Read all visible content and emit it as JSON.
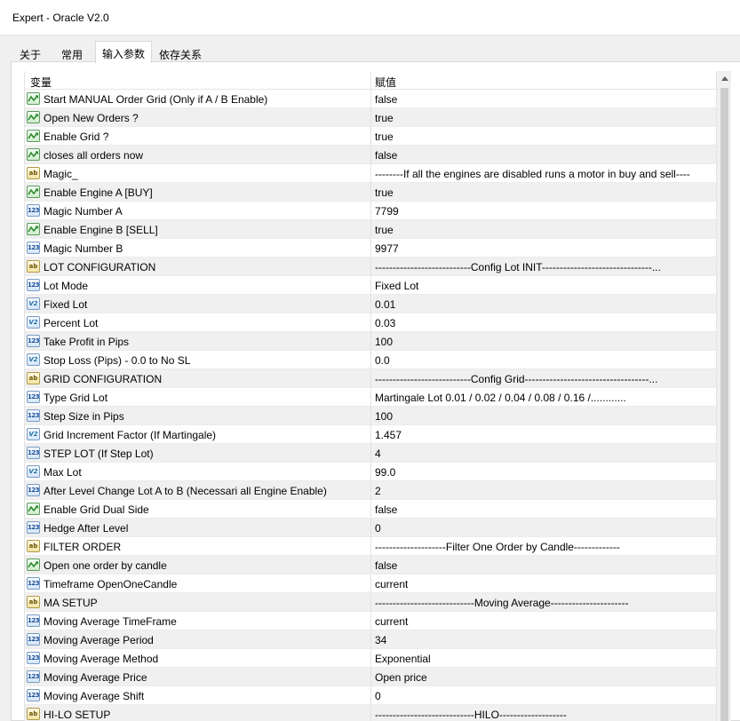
{
  "window": {
    "title": "Expert - Oracle V2.0"
  },
  "tabs": [
    {
      "label": "关于"
    },
    {
      "label": "常用"
    },
    {
      "label": "输入参数"
    },
    {
      "label": "依存关系"
    }
  ],
  "active_tab": "输入参数",
  "table": {
    "columns": [
      "变量",
      "赋值"
    ],
    "rows": [
      {
        "type": "bool",
        "icon": "bool-icon",
        "name": "Start MANUAL Order  Grid  (Only if A / B Enable)",
        "value": "false"
      },
      {
        "type": "bool",
        "icon": "bool-icon",
        "name": "Open New Orders ?",
        "value": "true"
      },
      {
        "type": "bool",
        "icon": "bool-icon",
        "name": "Enable Grid ?",
        "value": "true"
      },
      {
        "type": "bool",
        "icon": "bool-icon",
        "name": "closes all orders now",
        "value": "false"
      },
      {
        "type": "str",
        "icon": "string-icon",
        "name": "Magic_",
        "value": "--------If all the engines are disabled runs a motor in buy and sell----"
      },
      {
        "type": "bool",
        "icon": "bool-icon",
        "name": "Enable Engine A   [BUY]",
        "value": "true"
      },
      {
        "type": "int",
        "icon": "integer-icon",
        "name": "Magic Number  A",
        "value": "7799"
      },
      {
        "type": "bool",
        "icon": "bool-icon",
        "name": "Enable Engine B   [SELL]",
        "value": "true"
      },
      {
        "type": "int",
        "icon": "integer-icon",
        "name": "Magic Number  B",
        "value": "9977"
      },
      {
        "type": "str",
        "icon": "string-icon",
        "name": "LOT CONFIGURATION",
        "value": "---------------------------Config Lot INIT-------------------------------..."
      },
      {
        "type": "int",
        "icon": "integer-icon",
        "name": "Lot Mode",
        "value": "Fixed Lot"
      },
      {
        "type": "dbl",
        "icon": "double-icon",
        "name": "Fixed Lot",
        "value": "0.01"
      },
      {
        "type": "dbl",
        "icon": "double-icon",
        "name": "Percent Lot",
        "value": "0.03"
      },
      {
        "type": "int",
        "icon": "integer-icon",
        "name": "Take Profit in Pips",
        "value": "100"
      },
      {
        "type": "dbl",
        "icon": "double-icon",
        "name": "Stop Loss (Pips) - 0.0 to No SL",
        "value": "0.0"
      },
      {
        "type": "str",
        "icon": "string-icon",
        "name": "GRID CONFIGURATION",
        "value": "---------------------------Config Grid-----------------------------------..."
      },
      {
        "type": "int",
        "icon": "integer-icon",
        "name": "Type Grid Lot",
        "value": "Martingale Lot  0.01 / 0.02 / 0.04 / 0.08 / 0.16 /............"
      },
      {
        "type": "int",
        "icon": "integer-icon",
        "name": "Step Size in Pips",
        "value": "100"
      },
      {
        "type": "dbl",
        "icon": "double-icon",
        "name": "Grid Increment Factor (If Martingale)",
        "value": "1.457"
      },
      {
        "type": "int",
        "icon": "integer-icon",
        "name": "STEP LOT (If  Step Lot)",
        "value": "4"
      },
      {
        "type": "dbl",
        "icon": "double-icon",
        "name": "Max Lot",
        "value": "99.0"
      },
      {
        "type": "int",
        "icon": "integer-icon",
        "name": "After Level Change Lot A to B (Necessari all Engine Enable)",
        "value": "2"
      },
      {
        "type": "bool",
        "icon": "bool-icon",
        "name": "Enable Grid Dual Side",
        "value": "false"
      },
      {
        "type": "int",
        "icon": "integer-icon",
        "name": "Hedge After Level",
        "value": "0"
      },
      {
        "type": "str",
        "icon": "string-icon",
        "name": "FILTER ORDER",
        "value": "--------------------Filter One Order by Candle-------------"
      },
      {
        "type": "bool",
        "icon": "bool-icon",
        "name": "Open one order by candle",
        "value": "false"
      },
      {
        "type": "int",
        "icon": "integer-icon",
        "name": "Timeframe OpenOneCandle",
        "value": "current"
      },
      {
        "type": "str",
        "icon": "string-icon",
        "name": "MA SETUP",
        "value": "----------------------------Moving Average----------------------"
      },
      {
        "type": "int",
        "icon": "integer-icon",
        "name": "Moving Average TimeFrame",
        "value": "current"
      },
      {
        "type": "int",
        "icon": "integer-icon",
        "name": "Moving Average Period",
        "value": "34"
      },
      {
        "type": "int",
        "icon": "integer-icon",
        "name": "Moving Average Method",
        "value": "Exponential"
      },
      {
        "type": "int",
        "icon": "integer-icon",
        "name": "Moving Average Price",
        "value": "Open price"
      },
      {
        "type": "int",
        "icon": "integer-icon",
        "name": "Moving Average Shift",
        "value": "0"
      },
      {
        "type": "str",
        "icon": "string-icon",
        "name": "HI-LO SETUP",
        "value": "----------------------------HILO-------------------"
      }
    ]
  },
  "icon_labels": {
    "str": "ab",
    "int": "123",
    "dbl": "V2"
  }
}
